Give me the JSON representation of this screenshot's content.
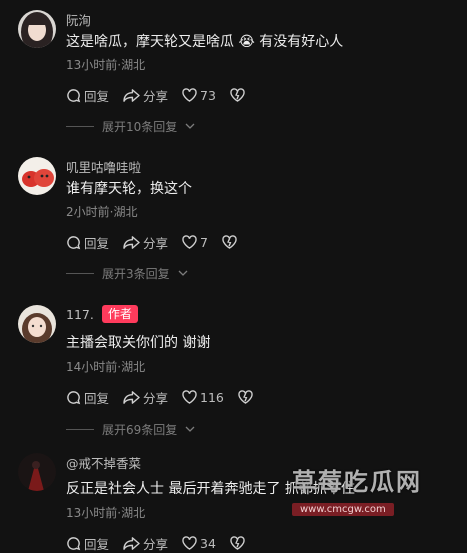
{
  "comments": [
    {
      "username": "阮洵",
      "text": "这是啥瓜，摩天轮又是啥瓜 😭 有没有好心人",
      "meta": "13小时前·湖北",
      "reply_label": "回复",
      "share_label": "分享",
      "likes": "73",
      "expand": "展开10条回复"
    },
    {
      "username": "叽里咕噜哇啦",
      "text": "谁有摩天轮，换这个",
      "meta": "2小时前·湖北",
      "reply_label": "回复",
      "share_label": "分享",
      "likes": "7",
      "expand": "展开3条回复"
    },
    {
      "username": "117.",
      "badge": "作者",
      "text": "主播会取关你们的 谢谢",
      "meta": "14小时前·湖北",
      "reply_label": "回复",
      "share_label": "分享",
      "likes": "116",
      "expand": "展开69条回复"
    },
    {
      "username": "@戒不掉香菜",
      "text": "反正是社会人士 最后开着奔驰走了 抓都抓不住",
      "meta": "13小时前·湖北",
      "reply_label": "回复",
      "share_label": "分享",
      "likes": "34"
    }
  ],
  "watermark": {
    "title": "草莓吃瓜网",
    "url": "www.cmcgw.com"
  },
  "colors": {
    "background": "#121212",
    "author_badge": "#ff3b5c"
  }
}
